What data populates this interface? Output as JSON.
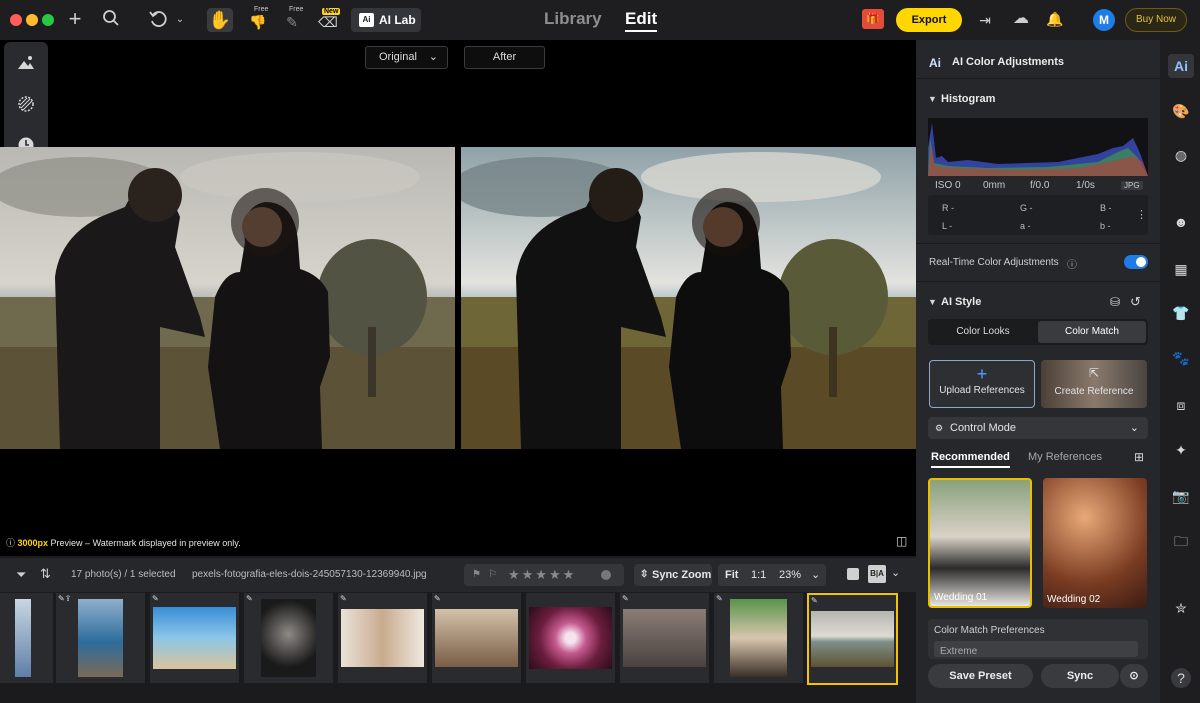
{
  "topbar": {
    "free_label_1": "Free",
    "free_label_2": "Free",
    "new_label": "New",
    "ailab_badge": "Ai",
    "ailab_label": "AI Lab",
    "tab_library": "Library",
    "tab_edit": "Edit",
    "export_label": "Export",
    "avatar_letter": "M",
    "buy_now_label": "Buy Now"
  },
  "canvas": {
    "compare_original": "Original",
    "compare_after": "After",
    "preview_size": "3000px",
    "preview_note": " Preview – Watermark displayed in preview only."
  },
  "bottombar": {
    "count": "17 photo(s) / 1 selected",
    "filename": "pexels-fotografia-eles-dois-245057130-12369940.jpg",
    "sync_zoom": "Sync Zoom",
    "fit": "Fit",
    "one_to_one": "1:1",
    "zoom": "23%"
  },
  "filmstrip": {
    "thumbs": [
      {
        "color": "#7aa0c4"
      },
      {
        "color": "#3f7fb3"
      },
      {
        "color": "#4d9bd4"
      },
      {
        "color": "#2b2b2b"
      },
      {
        "color": "#c9b39c"
      },
      {
        "color": "#9a7b5e"
      },
      {
        "color": "#b04a7a"
      },
      {
        "color": "#6d5d55"
      },
      {
        "color": "#3f6e3a"
      },
      {
        "color": "#b9b2a4"
      }
    ]
  },
  "panel": {
    "header": "AI Color Adjustments",
    "header_badge": "Ai",
    "histogram_title": "Histogram",
    "iso": "ISO 0",
    "focal": "0mm",
    "aperture": "f/0.0",
    "shutter": "1/0s",
    "format": "JPG",
    "r_label": "R -",
    "g_label": "G -",
    "b_label": "B -",
    "l_label": "L -",
    "a_label": "a -",
    "b2_label": "b -",
    "realtime_label": "Real-Time Color Adjustments",
    "ai_style_title": "AI Style",
    "tab_color_looks": "Color Looks",
    "tab_color_match": "Color Match",
    "upload_label": "Upload References",
    "create_label": "Create Reference",
    "control_mode": "Control Mode",
    "tab_recommended": "Recommended",
    "tab_my_references": "My References",
    "wedding_01": "Wedding 01",
    "wedding_02": "Wedding 02",
    "prefs_label": "Color Match Preferences",
    "prefs_value": "Extreme",
    "save_preset": "Save Preset",
    "sync": "Sync"
  },
  "colors": {
    "accent_yellow": "#ffd600",
    "accent_blue": "#1e7ce8"
  }
}
